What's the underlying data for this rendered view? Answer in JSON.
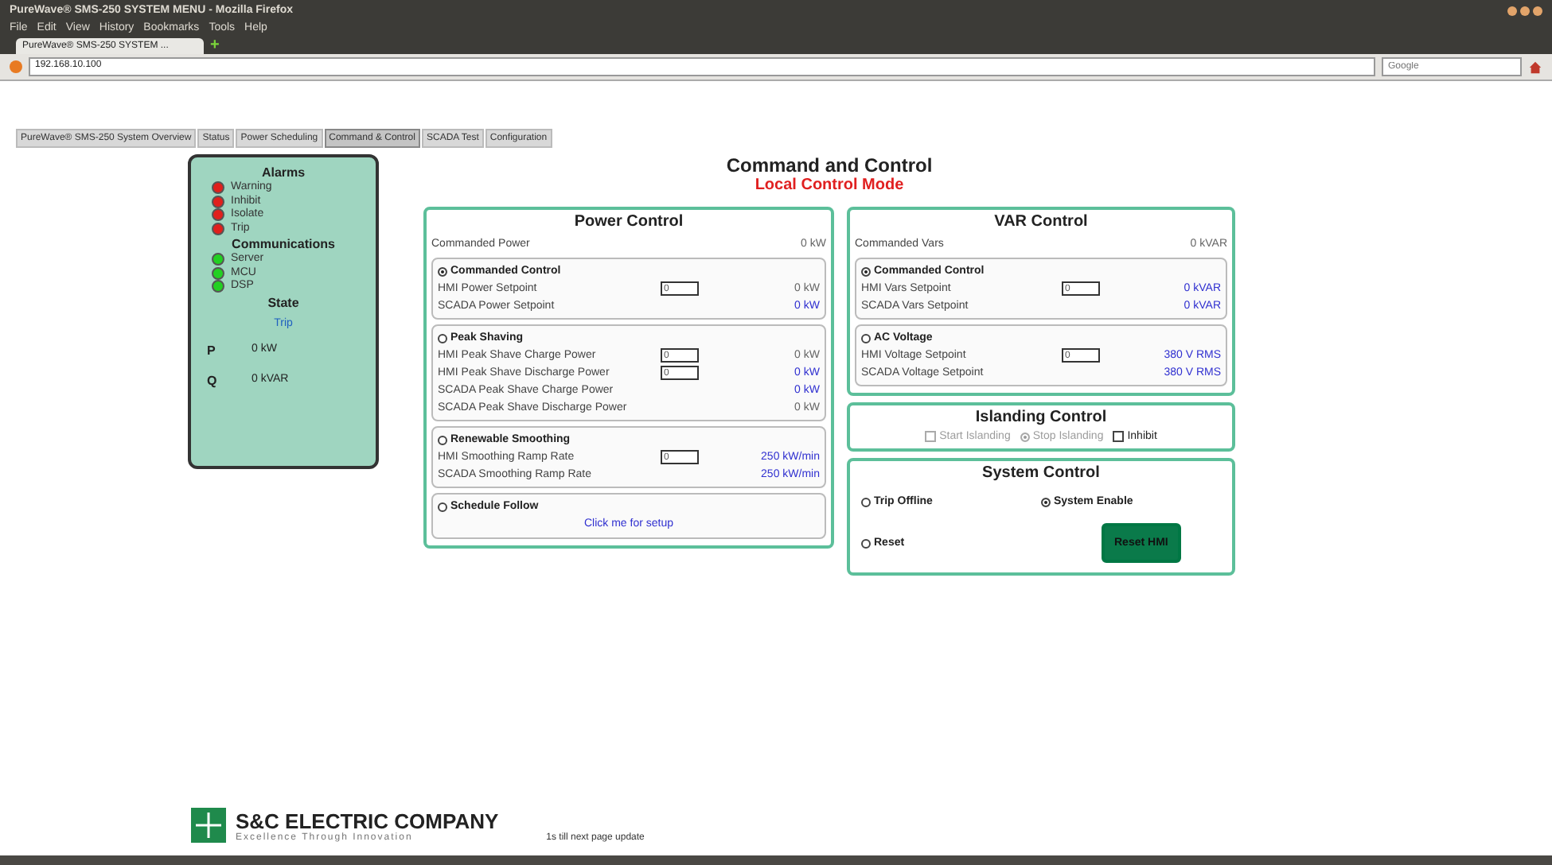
{
  "browser": {
    "title": "PureWave® SMS-250 SYSTEM MENU - Mozilla Firefox",
    "menu": [
      "File",
      "Edit",
      "View",
      "History",
      "Bookmarks",
      "Tools",
      "Help"
    ],
    "tab": "PureWave® SMS-250 SYSTEM ...",
    "new_tab": "+",
    "url": "192.168.10.100",
    "search_placeholder": "Google"
  },
  "nav_tabs": [
    {
      "label": "PureWave® SMS-250 System Overview",
      "selected": false
    },
    {
      "label": "Status",
      "selected": false
    },
    {
      "label": "Power Scheduling",
      "selected": false
    },
    {
      "label": "Command & Control",
      "selected": true
    },
    {
      "label": "SCADA Test",
      "selected": false
    },
    {
      "label": "Configuration",
      "selected": false
    }
  ],
  "status_panel": {
    "alarms_title": "Alarms",
    "alarms": [
      {
        "label": "Warning",
        "color": "#e0201c"
      },
      {
        "label": "Inhibit",
        "color": "#e0201c"
      },
      {
        "label": "Isolate",
        "color": "#e0201c"
      },
      {
        "label": "Trip",
        "color": "#e0201c"
      }
    ],
    "comms_title": "Communications",
    "comms": [
      {
        "label": "Server",
        "color": "#22d022"
      },
      {
        "label": "MCU",
        "color": "#22d022"
      },
      {
        "label": "DSP",
        "color": "#22d022"
      }
    ],
    "state_title": "State",
    "state": "Trip",
    "readings": [
      {
        "label": "P",
        "value": "0 kW"
      },
      {
        "label": "Q",
        "value": "0 kVAR"
      }
    ]
  },
  "page_title": "Command and Control",
  "mode": "Local Control Mode",
  "power_control": {
    "title": "Power Control",
    "top": {
      "label": "Commanded Power",
      "value": "0 kW",
      "accent": false
    },
    "groups": [
      {
        "label": "Commanded Control",
        "selected": true,
        "rows": [
          {
            "label": "HMI Power Setpoint",
            "input": "0",
            "value": "0 kW",
            "accent": false
          },
          {
            "label": "SCADA Power Setpoint",
            "value": "0 kW",
            "accent": true
          }
        ]
      },
      {
        "label": "Peak Shaving",
        "selected": false,
        "rows": [
          {
            "label": "HMI Peak Shave Charge Power",
            "input": "0",
            "value": "0 kW",
            "accent": false
          },
          {
            "label": "HMI Peak Shave Discharge Power",
            "input": "0",
            "value": "0 kW",
            "accent": true
          },
          {
            "label": "SCADA Peak Shave Charge Power",
            "value": "0 kW",
            "accent": true
          },
          {
            "label": "SCADA Peak Shave Discharge Power",
            "value": "0 kW",
            "accent": false
          }
        ]
      },
      {
        "label": "Renewable Smoothing",
        "selected": false,
        "rows": [
          {
            "label": "HMI Smoothing Ramp Rate",
            "input": "0",
            "value": "250 kW/min",
            "accent": true
          },
          {
            "label": "SCADA Smoothing Ramp Rate",
            "value": "250 kW/min",
            "accent": true
          }
        ]
      },
      {
        "label": "Schedule Follow",
        "selected": false,
        "link": "Click me for setup"
      }
    ]
  },
  "var_control": {
    "title": "VAR Control",
    "top": {
      "label": "Commanded Vars",
      "value": "0 kVAR",
      "accent": false
    },
    "groups": [
      {
        "label": "Commanded Control",
        "selected": true,
        "rows": [
          {
            "label": "HMI Vars Setpoint",
            "input": "0",
            "value": "0 kVAR",
            "accent": true
          },
          {
            "label": "SCADA Vars Setpoint",
            "value": "0 kVAR",
            "accent": true
          }
        ]
      },
      {
        "label": "AC Voltage",
        "selected": false,
        "rows": [
          {
            "label": "HMI Voltage Setpoint",
            "input": "0",
            "value": "380 V RMS",
            "accent": true
          },
          {
            "label": "SCADA Voltage Setpoint",
            "value": "380 V RMS",
            "accent": true
          }
        ]
      }
    ]
  },
  "islanding_control": {
    "title": "Islanding Control",
    "options": [
      {
        "kind": "checkbox",
        "label": "Start Islanding",
        "checked": false,
        "disabled": true
      },
      {
        "kind": "radio",
        "label": "Stop Islanding",
        "checked": true,
        "disabled": true
      },
      {
        "kind": "checkbox",
        "label": "Inhibit",
        "checked": false,
        "disabled": false
      }
    ]
  },
  "system_control": {
    "title": "System Control",
    "options": [
      {
        "label": "Trip Offline",
        "selected": false
      },
      {
        "label": "System Enable",
        "selected": true
      },
      {
        "label": "Reset",
        "selected": false
      }
    ],
    "button": "Reset HMI"
  },
  "footer": {
    "company": "S&C ELECTRIC COMPANY",
    "tagline": "Excellence Through Innovation",
    "update": "1s till next page update"
  }
}
